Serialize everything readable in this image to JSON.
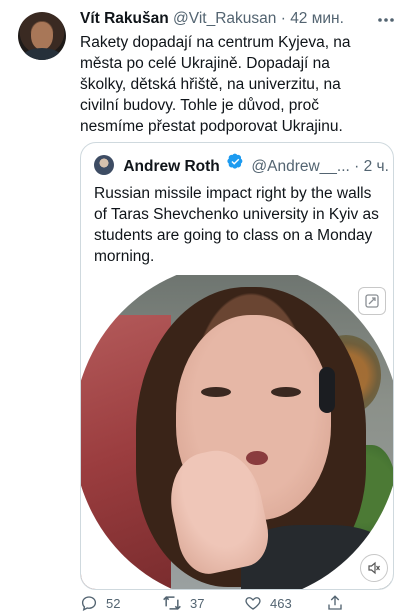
{
  "tweet": {
    "author_name": "Vít Rakušan",
    "author_handle": "@Vit_Rakusan",
    "separator": "·",
    "time": "42 мин.",
    "text": "Rakety dopadají na centrum Kyjeva, na města po celé Ukrajině. Dopadají na školky, dětská hřiště, na univerzitu, na civilní budovy. Tohle je důvod, proč nesmíme přestat podporovat Ukrajinu."
  },
  "quoted": {
    "author_name": "Andrew Roth",
    "author_handle": "@Andrew__...",
    "separator": "·",
    "time": "2 ч.",
    "text": "Russian missile impact right by the walls of Taras Shevchenko university in Kyiv as students are going to class on a Monday morning."
  },
  "stats": {
    "replies": "52",
    "retweets": "37",
    "likes": "463"
  },
  "icons": {
    "more": "more-icon",
    "verified": "verified-badge-icon",
    "expand": "expand-media-icon",
    "volume": "volume-icon",
    "reply": "reply-icon",
    "retweet": "retweet-icon",
    "like": "like-icon",
    "share": "share-icon"
  },
  "colors": {
    "verified": "#1d9bf0",
    "muted": "#536471",
    "border": "#cfd9de"
  }
}
